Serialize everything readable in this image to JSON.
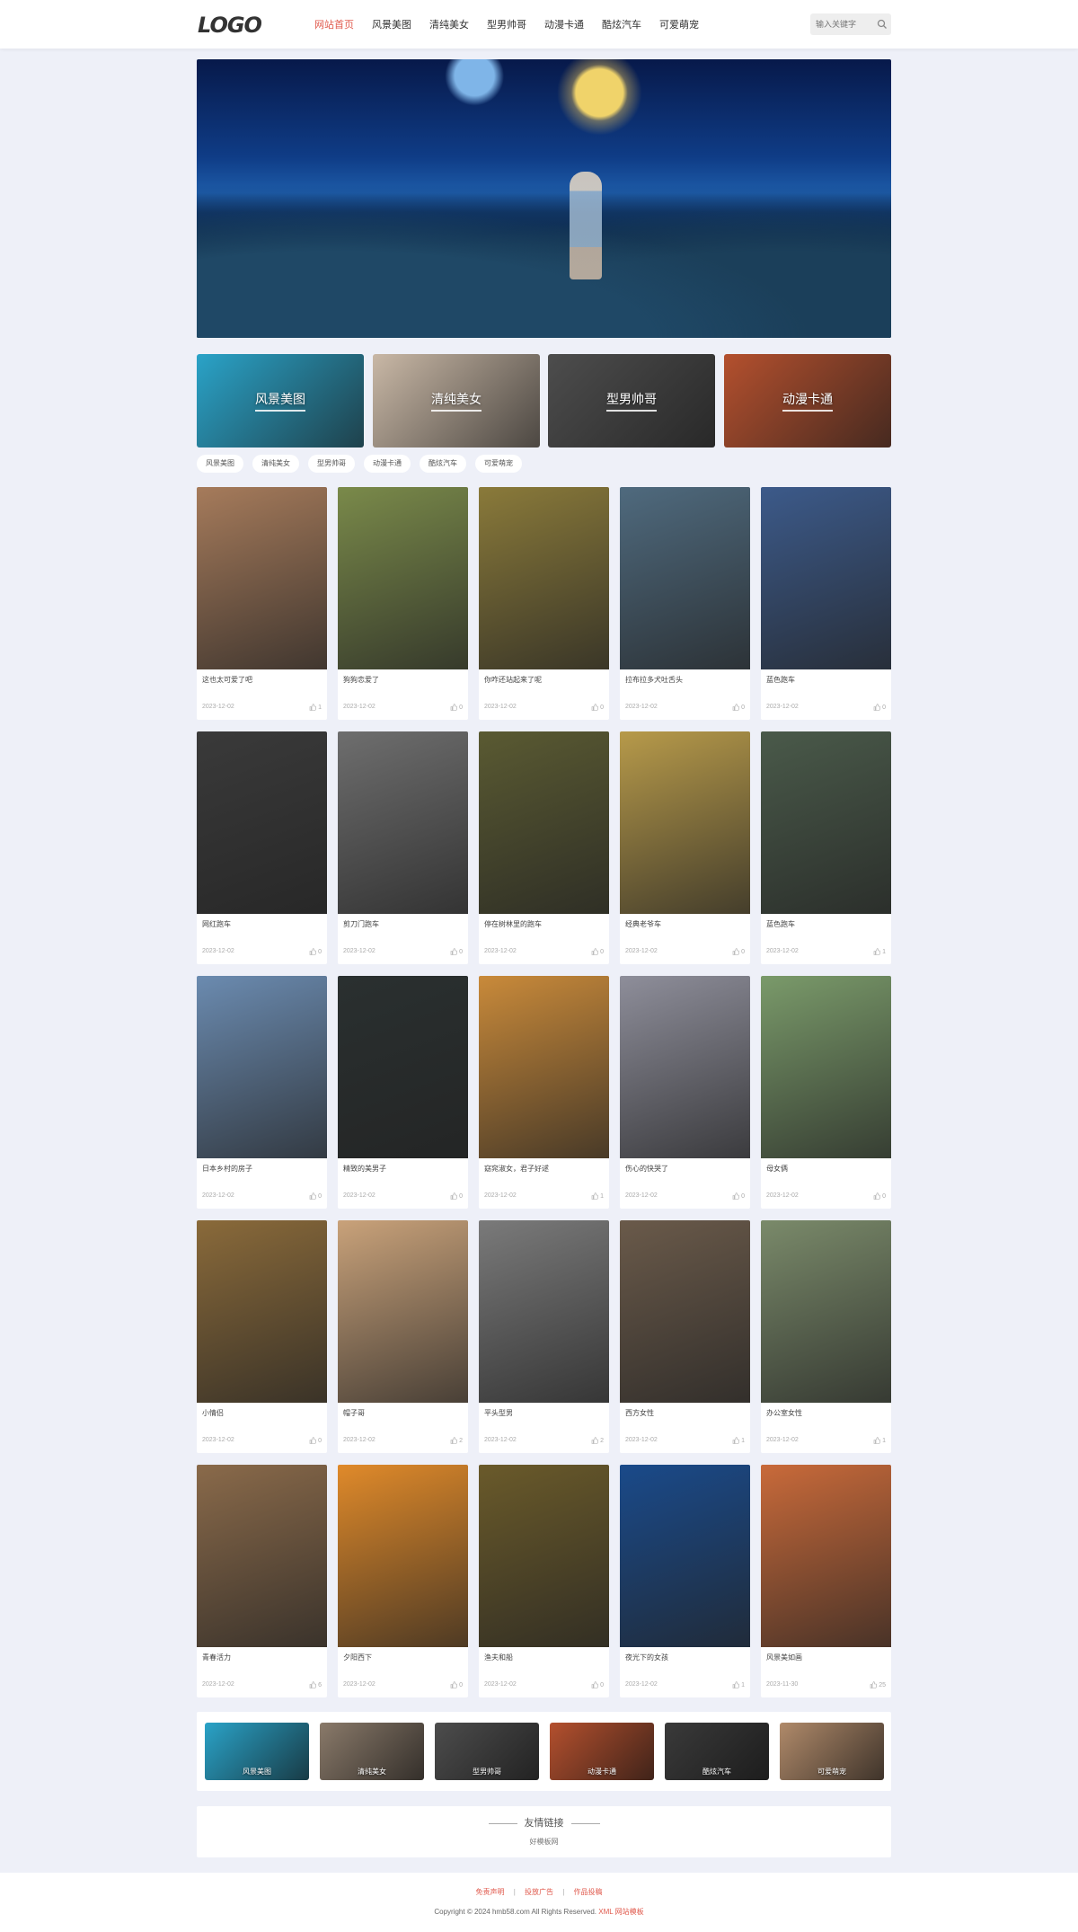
{
  "header": {
    "logo": "LOGO",
    "nav": [
      "网站首页",
      "风景美图",
      "清纯美女",
      "型男帅哥",
      "动漫卡通",
      "酷炫汽车",
      "可爱萌宠"
    ],
    "active_index": 0,
    "search_placeholder": "输入关键字"
  },
  "categories": [
    {
      "label": "风景美图",
      "color": "#2aa3c8"
    },
    {
      "label": "清纯美女",
      "color": "#c9b8a6"
    },
    {
      "label": "型男帅哥",
      "color": "#4d4d4d"
    },
    {
      "label": "动漫卡通",
      "color": "#b4502e"
    }
  ],
  "tags": [
    "风景美图",
    "清纯美女",
    "型男帅哥",
    "动漫卡通",
    "酷炫汽车",
    "可爱萌宠"
  ],
  "cards": [
    {
      "title": "这也太可爱了吧",
      "date": "2023-12-02",
      "likes": "1",
      "color": "#a67b5b"
    },
    {
      "title": "狗狗恋爱了",
      "date": "2023-12-02",
      "likes": "0",
      "color": "#7a8a4a"
    },
    {
      "title": "你咋还站起来了呢",
      "date": "2023-12-02",
      "likes": "0",
      "color": "#8a7a3a"
    },
    {
      "title": "拉布拉多犬吐舌头",
      "date": "2023-12-02",
      "likes": "0",
      "color": "#4f6a7e"
    },
    {
      "title": "蓝色跑车",
      "date": "2023-12-02",
      "likes": "0",
      "color": "#3c5a8a"
    },
    {
      "title": "网红跑车",
      "date": "2023-12-02",
      "likes": "0",
      "color": "#3a3a3a"
    },
    {
      "title": "剪刀门跑车",
      "date": "2023-12-02",
      "likes": "0",
      "color": "#6e6e6e"
    },
    {
      "title": "停在树林里的跑车",
      "date": "2023-12-02",
      "likes": "0",
      "color": "#5a5a32"
    },
    {
      "title": "经典老爷车",
      "date": "2023-12-02",
      "likes": "0",
      "color": "#b79a4a"
    },
    {
      "title": "蓝色跑车",
      "date": "2023-12-02",
      "likes": "1",
      "color": "#4a5a4a"
    },
    {
      "title": "日本乡村的房子",
      "date": "2023-12-02",
      "likes": "0",
      "color": "#6b8bb0"
    },
    {
      "title": "精致的美男子",
      "date": "2023-12-02",
      "likes": "0",
      "color": "#2a3030"
    },
    {
      "title": "窈窕淑女，君子好逑",
      "date": "2023-12-02",
      "likes": "1",
      "color": "#c98a3a"
    },
    {
      "title": "伤心的快哭了",
      "date": "2023-12-02",
      "likes": "0",
      "color": "#8e8e9a"
    },
    {
      "title": "母女俩",
      "date": "2023-12-02",
      "likes": "0",
      "color": "#7a9a6a"
    },
    {
      "title": "小情侣",
      "date": "2023-12-02",
      "likes": "0",
      "color": "#8a6a3a"
    },
    {
      "title": "帽子哥",
      "date": "2023-12-02",
      "likes": "2",
      "color": "#c9a27a"
    },
    {
      "title": "平头型男",
      "date": "2023-12-02",
      "likes": "2",
      "color": "#7a7a7a"
    },
    {
      "title": "西方女性",
      "date": "2023-12-02",
      "likes": "1",
      "color": "#6a5a4a"
    },
    {
      "title": "办公室女性",
      "date": "2023-12-02",
      "likes": "1",
      "color": "#7a8a6a"
    },
    {
      "title": "青春活力",
      "date": "2023-12-02",
      "likes": "6",
      "color": "#8a6a4a"
    },
    {
      "title": "夕阳西下",
      "date": "2023-12-02",
      "likes": "0",
      "color": "#e08a2a"
    },
    {
      "title": "渔夫和船",
      "date": "2023-12-02",
      "likes": "0",
      "color": "#6a5a2a"
    },
    {
      "title": "夜光下的女孩",
      "date": "2023-12-02",
      "likes": "1",
      "color": "#1a4a8a"
    },
    {
      "title": "风景美如画",
      "date": "2023-11-30",
      "likes": "25",
      "color": "#c96a3a"
    }
  ],
  "strip": [
    {
      "label": "风景美图",
      "color": "#2aa3c8"
    },
    {
      "label": "清纯美女",
      "color": "#8a7a6a"
    },
    {
      "label": "型男帅哥",
      "color": "#4d4d4d"
    },
    {
      "label": "动漫卡通",
      "color": "#b4502e"
    },
    {
      "label": "酷炫汽车",
      "color": "#3a3a3a"
    },
    {
      "label": "可爱萌宠",
      "color": "#b08a6a"
    }
  ],
  "links": {
    "title": "友情链接",
    "items": [
      "好模板网"
    ]
  },
  "footer": {
    "nav": [
      "免责声明",
      "投放广告",
      "作品投稿"
    ],
    "copyright_prefix": "Copyright © 2024 hmb58.com All Rights Reserved.",
    "copyright_accent": "XML 网站模板"
  }
}
